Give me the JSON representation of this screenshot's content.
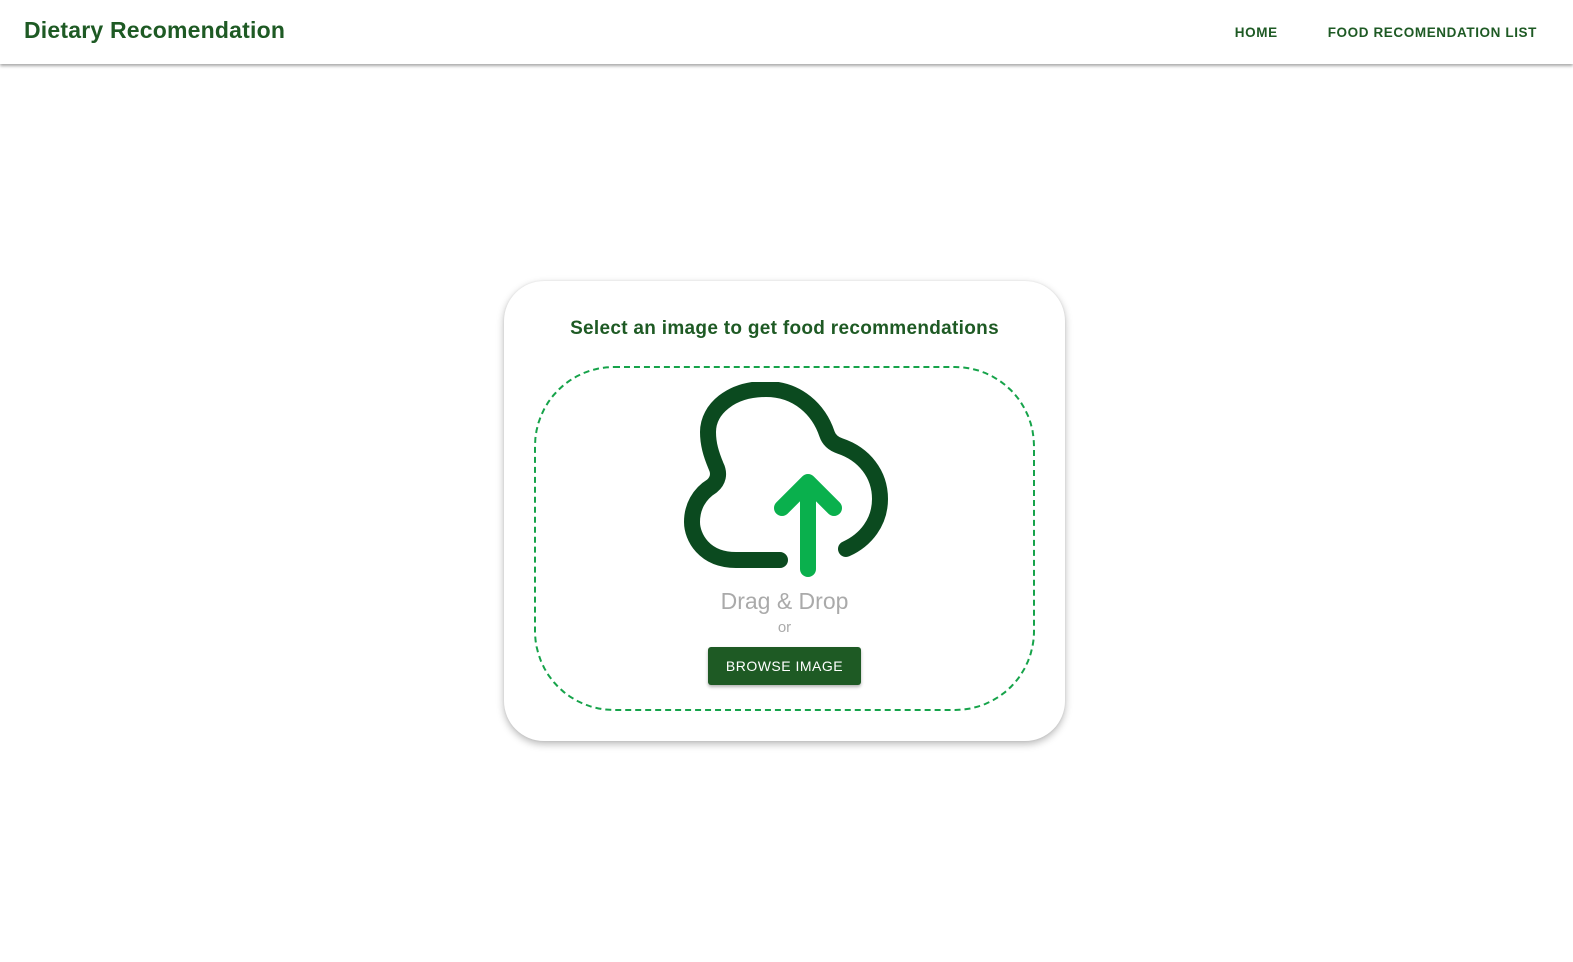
{
  "appbar": {
    "title": "Dietary Recomendation",
    "nav": [
      {
        "label": "HOME"
      },
      {
        "label": "FOOD RECOMENDATION LIST"
      }
    ]
  },
  "upload": {
    "heading": "Select an image to get food recommendations",
    "icon": "cloud-upload-icon",
    "drag_drop_label": "Drag & Drop",
    "or_label": "or",
    "browse_button_label": "BROWSE IMAGE"
  },
  "colors": {
    "brand_green": "#1e5a24",
    "cloud_dark_green": "#0b4a1f",
    "arrow_green": "#0ab04d",
    "dashed_border": "#16a34a",
    "muted_text": "#aaaaaa"
  }
}
